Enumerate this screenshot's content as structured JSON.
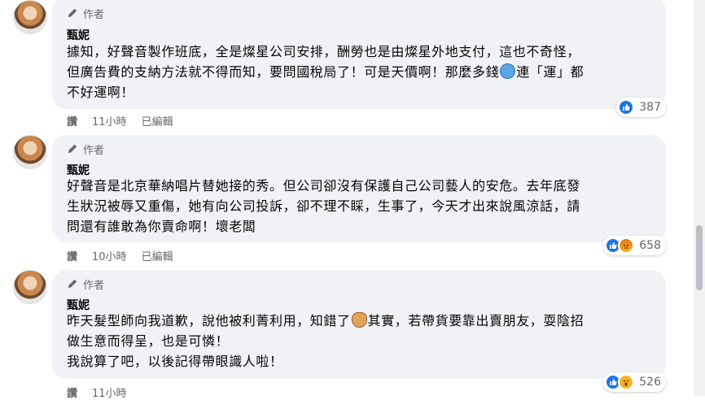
{
  "comments": [
    {
      "author_badge": "作者",
      "name": "甄妮",
      "lines": [
        "據知，好聲音製作班底，全是燦星公司安排，酬勞也是由燦星外地支付，這也不奇怪，",
        "但廣告費的支納方法就不得而知，要問國稅局了！可是天價啊！那麼多錢",
        "連「運」都",
        "不好運啊！"
      ],
      "reaction_count": "387",
      "actions": {
        "like": "讚",
        "time": "11小時",
        "edited": "已編輯"
      }
    },
    {
      "author_badge": "作者",
      "name": "甄妮",
      "lines": [
        "好聲音是北京華納唱片替她接的秀。但公司卻沒有保護自己公司藝人的安危。去年底發",
        "生狀況被辱又重傷，她有向公司投訴，卻不理不睬，生事了，今天才出來說風涼話，請",
        "問還有誰敢為你賣命啊！壞老闆"
      ],
      "reaction_count": "658",
      "actions": {
        "like": "讚",
        "time": "10小時",
        "edited": "已編輯"
      }
    },
    {
      "author_badge": "作者",
      "name": "甄妮",
      "lines": [
        "昨天髮型師向我道歉，說他被利菁利用，知錯了",
        "其實，若帶貨要靠出賣朋友，耍陰招",
        "做生意而得呈，也是可憐！",
        "我說算了吧，以後記得帶眼識人啦！"
      ],
      "reaction_count": "526",
      "actions": {
        "like": "讚",
        "time": "11小時"
      }
    }
  ],
  "icons": {
    "pencil": "pencil-icon",
    "like": "like-reaction-icon",
    "angry": "angry-reaction-icon",
    "wow": "wow-reaction-icon"
  },
  "colors": {
    "bubble": "#f0f2f5",
    "like_blue": "#1b74e4",
    "meta_gray": "#65676b"
  }
}
